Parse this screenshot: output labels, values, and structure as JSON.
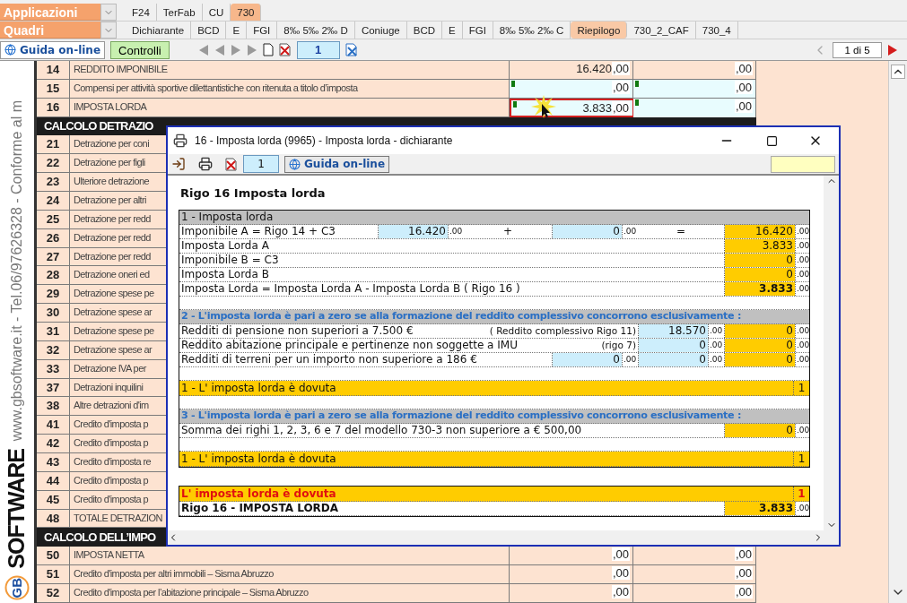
{
  "top_menu": {
    "label": "Applicazioni",
    "tabs": [
      {
        "label": "F24",
        "selected": false
      },
      {
        "label": "TerFab",
        "selected": false
      },
      {
        "label": "CU",
        "selected": false
      },
      {
        "label": "730",
        "selected": true
      }
    ]
  },
  "quadri_menu": {
    "label": "Quadri",
    "tabs": [
      {
        "label": "Dichiarante",
        "selected": false
      },
      {
        "label": "BCD",
        "selected": false
      },
      {
        "label": "E",
        "selected": false
      },
      {
        "label": "FGI",
        "selected": false
      },
      {
        "label": "8‰ 5‰ 2‰ D",
        "selected": false
      },
      {
        "label": "Coniuge",
        "selected": false
      },
      {
        "label": "BCD",
        "selected": false
      },
      {
        "label": "E",
        "selected": false
      },
      {
        "label": "FGI",
        "selected": false
      },
      {
        "label": "8‰ 5‰ 2‰ C",
        "selected": false
      },
      {
        "label": "Riepilogo",
        "selected": true
      },
      {
        "label": "730_2_CAF",
        "selected": false
      },
      {
        "label": "730_4",
        "selected": false
      }
    ]
  },
  "toolbar": {
    "help_button": "Guida on-line",
    "checks_button": "Controlli",
    "page_field": "1",
    "pager": "1 di 5"
  },
  "side_strip": {
    "contact": "www.gbsoftware.it - Tel.06/97626328 - Conforme al m",
    "logo_mark": "GB",
    "logo_text": "SOFTWARE"
  },
  "form": {
    "rows": [
      {
        "kind": "row",
        "number": "14",
        "description": "REDDITO IMPONIBILE",
        "cells": [
          {
            "value": "16.420",
            "decimals": ",00",
            "input": false,
            "selected": false
          },
          {
            "decimals": ",00",
            "input": false,
            "selected": false
          }
        ]
      },
      {
        "kind": "row",
        "number": "15",
        "description": "Compensi per attività sportive dilettantistiche con ritenuta a titolo d’imposta",
        "cells": [
          {
            "decimals": ",00",
            "input": true,
            "selected": false
          },
          {
            "decimals": ",00",
            "input": true,
            "selected": false
          }
        ]
      },
      {
        "kind": "row",
        "number": "16",
        "description": "IMPOSTA LORDA",
        "cells": [
          {
            "value": "3.833",
            "decimals": ",00",
            "input": true,
            "selected": true
          },
          {
            "decimals": ",00",
            "input": true,
            "selected": false
          }
        ]
      },
      {
        "kind": "header",
        "title": "CALCOLO DETRAZIO"
      },
      {
        "kind": "row",
        "number": "21",
        "description": "Detrazione per coni"
      },
      {
        "kind": "row",
        "number": "22",
        "description": "Detrazione per figli"
      },
      {
        "kind": "row",
        "number": "23",
        "description": "Ulteriore detrazione"
      },
      {
        "kind": "row",
        "number": "24",
        "description": "Detrazione per altri"
      },
      {
        "kind": "row",
        "number": "25",
        "description": "Detrazione per redd"
      },
      {
        "kind": "row",
        "number": "26",
        "description": "Detrazione per redd"
      },
      {
        "kind": "row",
        "number": "27",
        "description": "Detrazione per redd"
      },
      {
        "kind": "row",
        "number": "28",
        "description": "Detrazione oneri ed"
      },
      {
        "kind": "row",
        "number": "29",
        "description": "Detrazione spese pe"
      },
      {
        "kind": "row",
        "number": "30",
        "description": "Detrazione spese ar"
      },
      {
        "kind": "row",
        "number": "31",
        "description": "Detrazione spese pe"
      },
      {
        "kind": "row",
        "number": "32",
        "description": "Detrazione spese ar"
      },
      {
        "kind": "row",
        "number": "33",
        "description": "Detrazione IVA per"
      },
      {
        "kind": "row",
        "number": "37",
        "description": "Detrazioni inquilini"
      },
      {
        "kind": "row",
        "number": "38",
        "description": "Altre detrazioni d'im"
      },
      {
        "kind": "row",
        "number": "41",
        "description": "Credito d'imposta p"
      },
      {
        "kind": "row",
        "number": "42",
        "description": "Credito d'imposta p"
      },
      {
        "kind": "row",
        "number": "43",
        "description": "Credito d'imposta re"
      },
      {
        "kind": "row",
        "number": "44",
        "description": "Credito d'imposta p"
      },
      {
        "kind": "row",
        "number": "45",
        "description": "Credito d'imposta p"
      },
      {
        "kind": "row",
        "number": "48",
        "description": "TOTALE DETRAZION"
      },
      {
        "kind": "header",
        "title": "CALCOLO DELL’IMPO"
      },
      {
        "kind": "row",
        "number": "50",
        "description": "IMPOSTA NETTA",
        "cells": [
          {
            "decimals": ",00",
            "input": false,
            "selected": false
          },
          {
            "decimals": ",00",
            "input": false,
            "selected": false
          }
        ]
      },
      {
        "kind": "row",
        "number": "51",
        "description": "Credito d'imposta per altri immobili – Sisma Abruzzo",
        "cells": [
          {
            "decimals": ",00",
            "input": false,
            "selected": false
          },
          {
            "decimals": ",00",
            "input": false,
            "selected": false
          }
        ]
      },
      {
        "kind": "row",
        "number": "52",
        "description": "Credito d'imposta per l’abitazione principale – Sisma Abruzzo",
        "cells": [
          {
            "decimals": ",00",
            "input": false,
            "selected": false
          },
          {
            "decimals": ",00",
            "input": false,
            "selected": false
          }
        ]
      }
    ]
  },
  "dialog": {
    "title": "16 - Imposta lorda (9965) - Imposta lorda - dichiarante",
    "page_field": "1",
    "help_button": "Guida on-line",
    "heading": "Rigo 16 Imposta lorda",
    "tables": [
      {
        "rows": [
          {
            "kind": "header",
            "text": "1 - Imposta lorda",
            "emphasis": false,
            "separated": false
          },
          {
            "kind": "line",
            "label": "Imponibile A = Rigo 14 + C3",
            "bold": false,
            "a": {
              "kind": "input",
              "value": "16.420",
              "decimals": ".00"
            },
            "b": {
              "kind": "op",
              "value": "+"
            },
            "c": {
              "kind": "input",
              "value": "0",
              "decimals": ".00"
            },
            "d": {
              "kind": "op",
              "value": "="
            },
            "result": {
              "value": "16.420",
              "decimals": ".00",
              "bold": false
            }
          },
          {
            "kind": "line",
            "label": "Imposta Lorda A",
            "bold": false,
            "result": {
              "value": "3.833",
              "decimals": ".00",
              "bold": false
            }
          },
          {
            "kind": "line",
            "label": "Imponibile B = C3",
            "bold": false,
            "result": {
              "value": "0",
              "decimals": ".00",
              "bold": false
            }
          },
          {
            "kind": "line",
            "label": "Imposta Lorda B",
            "bold": false,
            "result": {
              "value": "0",
              "decimals": ".00",
              "bold": false
            }
          },
          {
            "kind": "line",
            "label": "Imposta Lorda = Imposta Lorda A - Imposta Lorda B ( Rigo 16 )",
            "bold": false,
            "result": {
              "value": "3.833",
              "decimals": ".00",
              "bold": true
            }
          },
          {
            "kind": "header",
            "text": "2 - L'imposta lorda è pari a zero se alla formazione del reddito complessivo concorrono esclusivamente :",
            "emphasis": true,
            "separated": true
          },
          {
            "kind": "line",
            "label": "Redditi di pensione non superiori a 7.500 €",
            "note": "( Reddito complessivo Rigo 11)",
            "bold": false,
            "d": {
              "kind": "input",
              "value": "18.570",
              "decimals": ".00"
            },
            "result": {
              "value": "0",
              "decimals": ".00",
              "bold": false
            }
          },
          {
            "kind": "line",
            "label": "Reddito abitazione principale e pertinenze non soggette a IMU",
            "note": "(rigo 7)",
            "bold": false,
            "d": {
              "kind": "input",
              "value": "0",
              "decimals": ".00"
            },
            "result": {
              "value": "0",
              "decimals": ".00",
              "bold": false
            }
          },
          {
            "kind": "line",
            "label": "Redditi di terreni per un importo non superiore a  186 €",
            "bold": false,
            "c": {
              "kind": "input",
              "value": "0",
              "decimals": ".00"
            },
            "d": {
              "kind": "input",
              "value": "0",
              "decimals": ".00"
            },
            "result": {
              "value": "0",
              "decimals": ".00",
              "bold": false
            }
          },
          {
            "kind": "band",
            "label": "1 - L' imposta lorda è dovuta",
            "flag": "1",
            "alert": false,
            "separated": true
          },
          {
            "kind": "header",
            "text": "3 - L'imposta lorda è pari a zero se alla formazione del reddito complessivo concorrono esclusivamente :",
            "emphasis": true,
            "separated": true
          },
          {
            "kind": "line",
            "label": "Somma dei righi 1, 2, 3, 6 e 7 del modello 730-3 non superiore a € 500,00",
            "bold": false,
            "result": {
              "value": "0",
              "decimals": ".00",
              "bold": false
            }
          },
          {
            "kind": "band",
            "label": "1 - L' imposta lorda è dovuta",
            "flag": "1",
            "alert": false,
            "separated": true
          }
        ]
      },
      {
        "rows": [
          {
            "kind": "band",
            "label": "L' imposta lorda è dovuta",
            "flag": "1",
            "alert": true,
            "separated": false
          },
          {
            "kind": "line",
            "label": "Rigo 16 -  IMPOSTA LORDA",
            "bold": true,
            "result": {
              "value": "3.833",
              "decimals": ".00",
              "bold": true
            }
          }
        ]
      }
    ]
  }
}
